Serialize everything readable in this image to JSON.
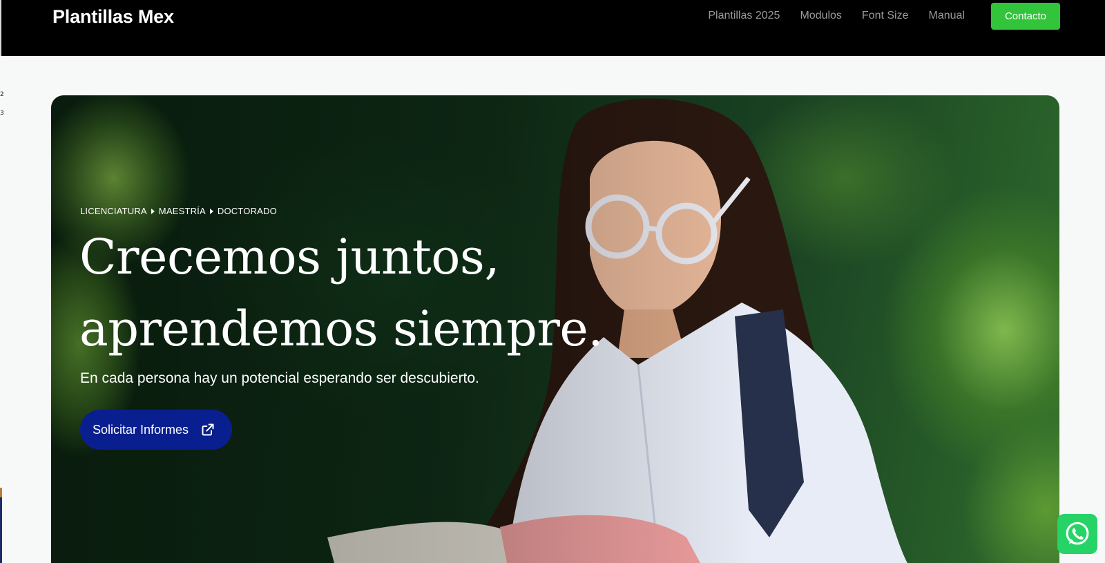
{
  "header": {
    "brand": "Plantillas Mex",
    "nav": [
      {
        "label": "Plantillas 2025"
      },
      {
        "label": "Modulos"
      },
      {
        "label": "Font Size"
      },
      {
        "label": "Manual"
      }
    ],
    "cta_label": "Contacto"
  },
  "edge": {
    "mark1": "2",
    "mark2": "3"
  },
  "hero": {
    "eyebrow": [
      "LICENCIATURA",
      "MAESTRÍA",
      "DOCTORADO"
    ],
    "headline_line1": "Crecemos juntos,",
    "headline_line2": "aprendemos siempre.",
    "subhead": "En cada persona hay un potencial esperando ser descubierto.",
    "cta_label": "Solicitar Informes",
    "cta_icon": "external-link-icon"
  },
  "floating": {
    "whatsapp_icon": "whatsapp-icon"
  },
  "colors": {
    "navbar": "#000000",
    "contact_button": "#32c43a",
    "cta_button": "#0a1f8f",
    "whatsapp": "#25d366"
  }
}
